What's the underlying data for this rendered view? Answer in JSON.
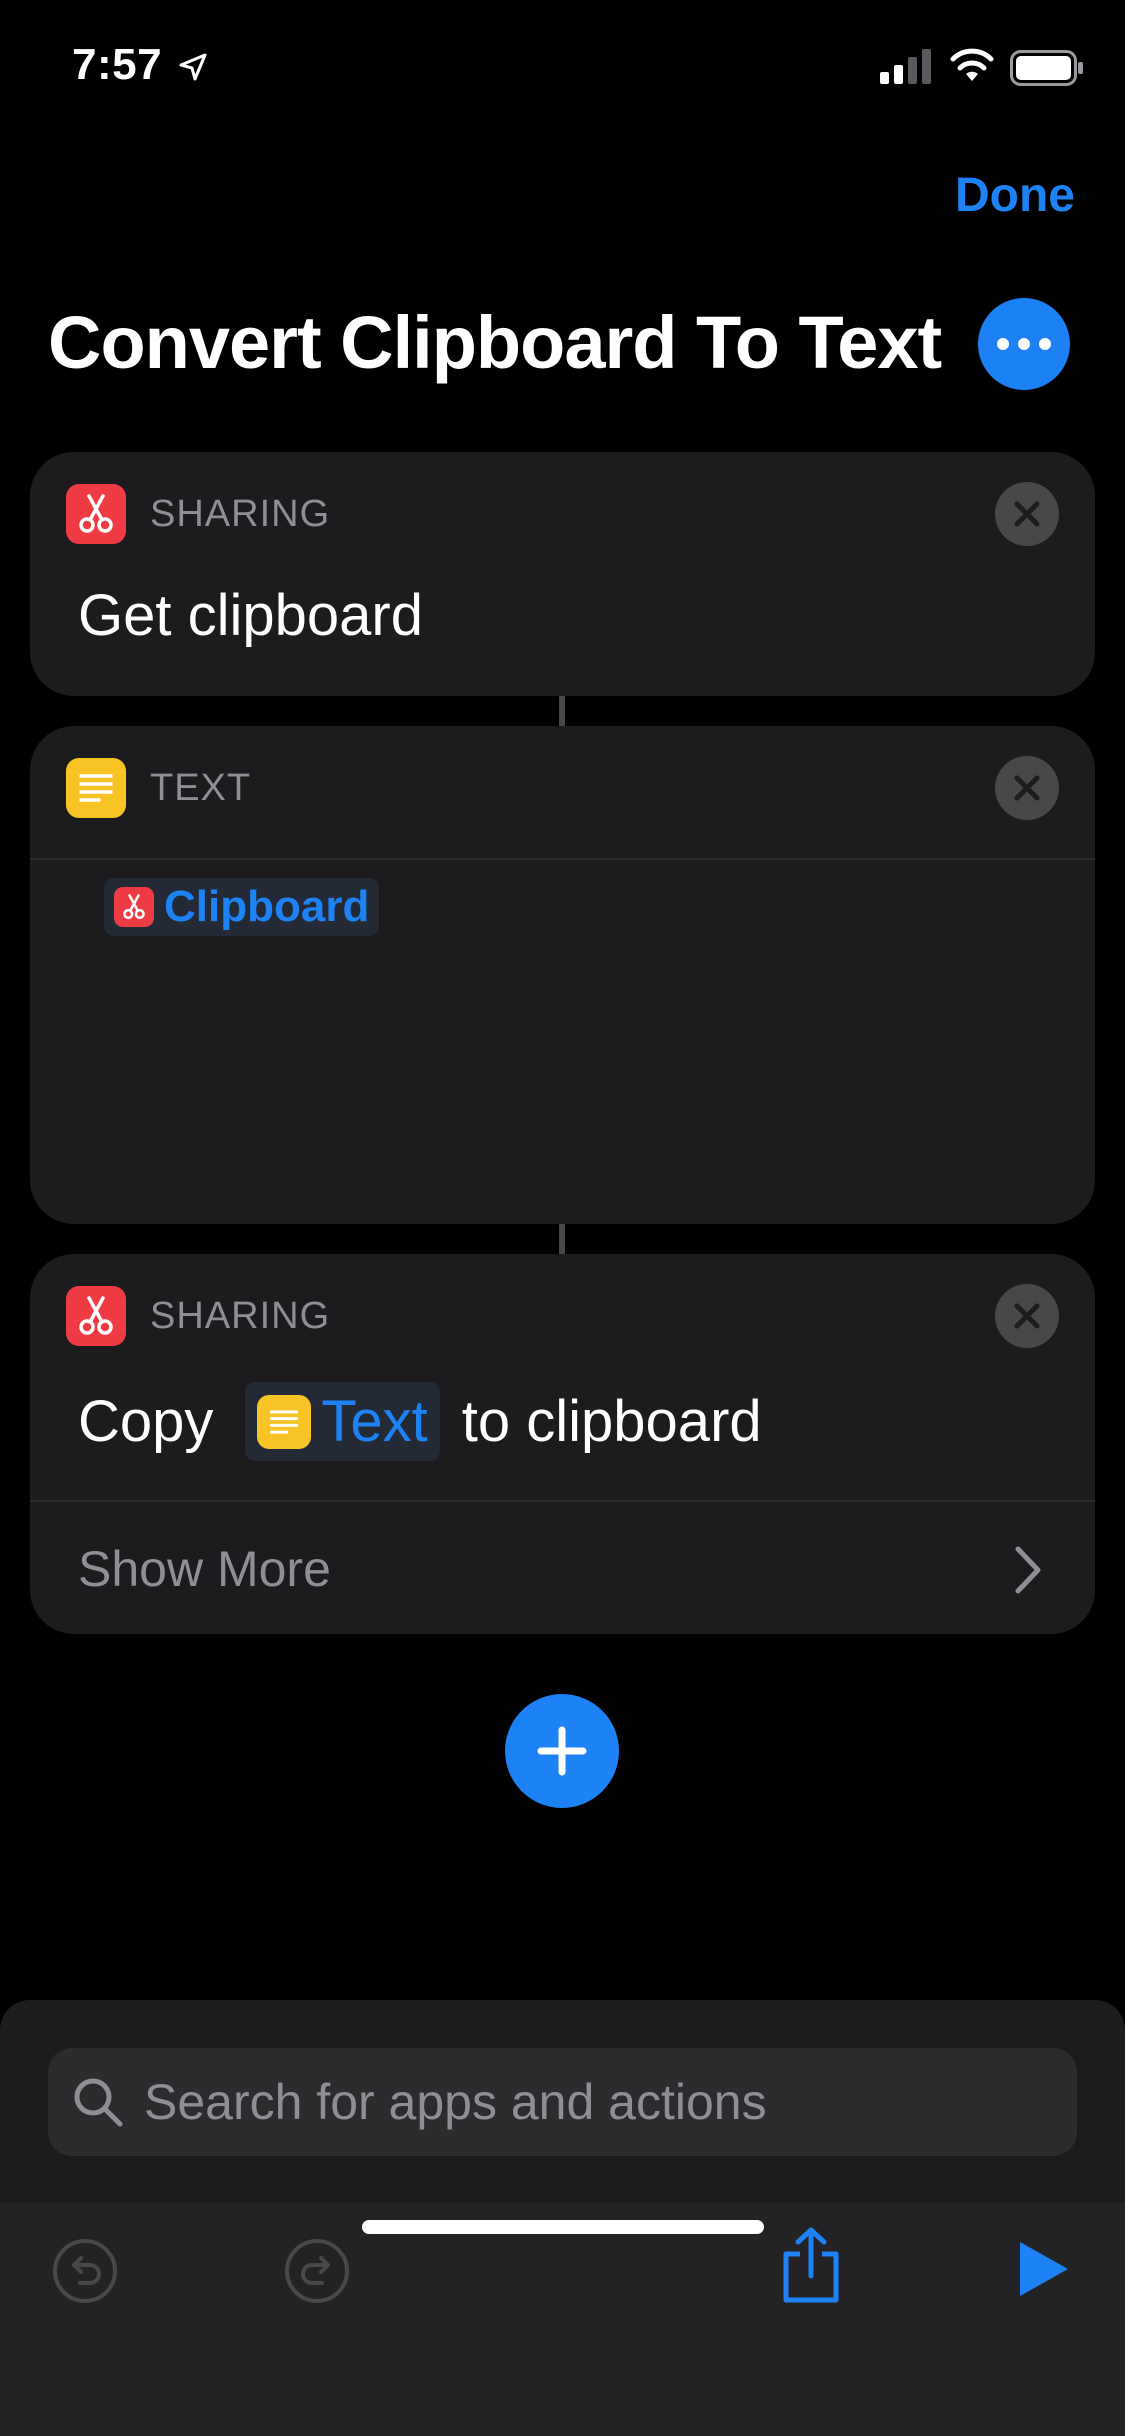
{
  "status_bar": {
    "time": "7:57",
    "icons": [
      "location-arrow-icon",
      "cellular-signal-icon",
      "wifi-icon",
      "battery-icon"
    ]
  },
  "header": {
    "done_label": "Done",
    "title": "Convert Clipboard To Text",
    "more_icon": "ellipsis-icon"
  },
  "actions": [
    {
      "category": "SHARING",
      "icon": "scissors-icon",
      "icon_color": "#ef3b44",
      "title": "Get clipboard"
    },
    {
      "category": "TEXT",
      "icon": "text-lines-icon",
      "icon_color": "#f7c325",
      "content_token": "Clipboard"
    },
    {
      "category": "SHARING",
      "icon": "scissors-icon",
      "icon_color": "#ef3b44",
      "title_prefix": "Copy",
      "title_token": "Text",
      "title_suffix": "to clipboard",
      "show_more_label": "Show More"
    }
  ],
  "search": {
    "placeholder": "Search for apps and actions"
  },
  "toolbar": {
    "icons": [
      "undo-icon",
      "redo-icon",
      "share-icon",
      "play-icon"
    ]
  },
  "colors": {
    "accent": "#1d82f5",
    "background": "#000000",
    "card": "#1c1c1e",
    "secondary_text": "#8e8e93"
  }
}
